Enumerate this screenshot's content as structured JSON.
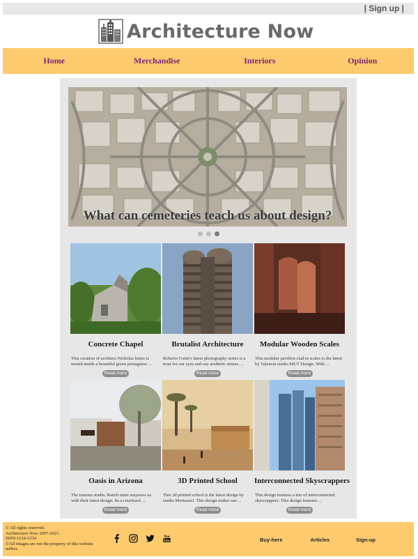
{
  "topbar": {
    "signup": "| Sign up |"
  },
  "logo": {
    "text": "Architecture Now",
    "icon": "city-buildings-icon"
  },
  "nav": {
    "items": [
      "Home",
      "Merchandise",
      "Interiors",
      "Opinion"
    ]
  },
  "hero": {
    "caption": "What can cemeteries teach us about design?",
    "slide_count": 3,
    "active_slide": 3
  },
  "cards": [
    {
      "title": "Concrete Chapel",
      "desc": "This creation of architect Nicholas burns is nested inside a beautiful green portuguese ...",
      "button": "Read more"
    },
    {
      "title": "Brutalist Architecture",
      "desc": "Roberto Conte's latest photography series is a treat for our eyes and our aesthetic senses. ...",
      "button": "Read more"
    },
    {
      "title": "Modular Wooden Scales",
      "desc": "This modular pavilion clad in scales is the latest by Valencia studio MUT Design. With ...",
      "button": "Read more"
    },
    {
      "title": "Oasis in Arizona",
      "desc": "The famous studio, Ranch mine surprises us with their latest design. Its a courtyard ....",
      "button": "Read more"
    },
    {
      "title": "3D Printed School",
      "desc": "This 3d printed school is the latest design by studio Mortazavi. This design makes use ...",
      "button": "Read more"
    },
    {
      "title": "Interconnected Skyscrappers",
      "desc": "This design features a trio of interconnected skyscrappers. This design features ...",
      "button": "Read more"
    }
  ],
  "footer": {
    "rights": "© All rights reserved.",
    "years": "Architecture Now 2007-2021.",
    "issn": "ISSN:1234-1234",
    "images": "©All images are not the property of this website author.",
    "social": [
      "facebook-icon",
      "instagram-icon",
      "twitter-icon",
      "youtube-icon"
    ],
    "links": [
      "Buy-here",
      "Articles",
      "Sign-up"
    ]
  },
  "colors": {
    "accent": "#fdcb6e",
    "nav_text": "#7b2474",
    "panel": "#e7e7e7"
  }
}
